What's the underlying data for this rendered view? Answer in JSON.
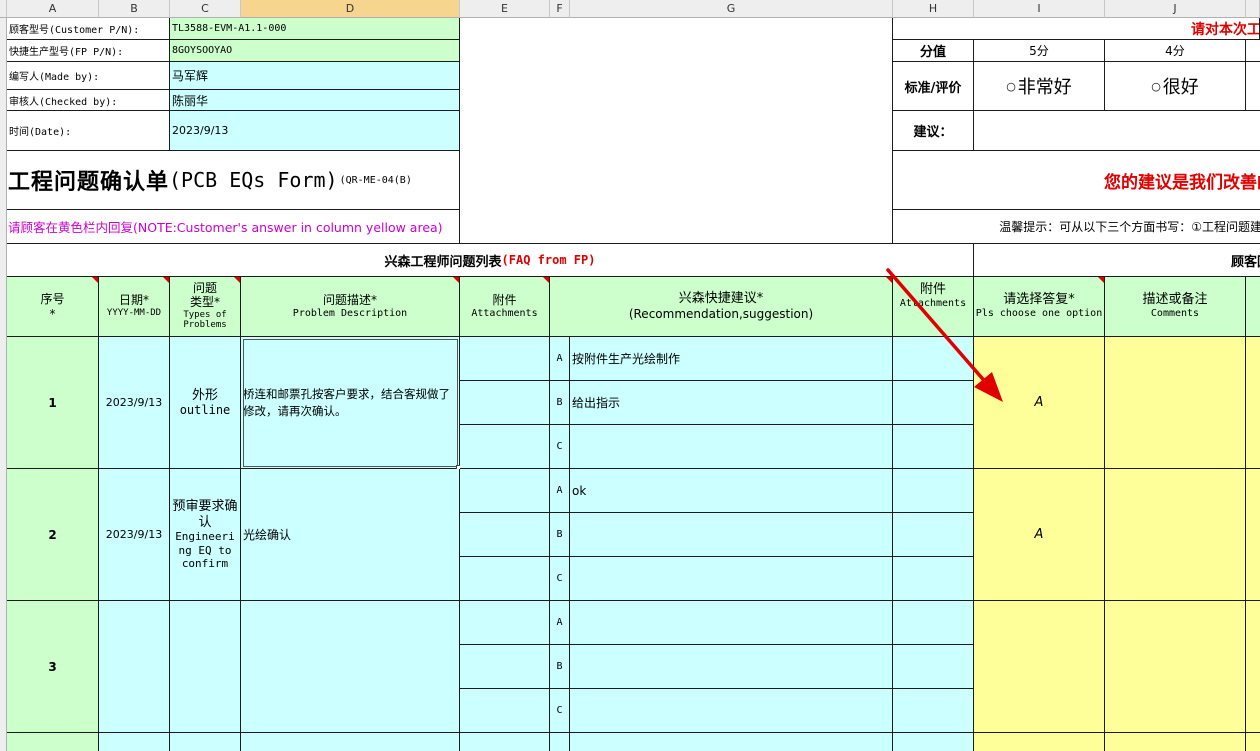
{
  "columns": [
    "A",
    "B",
    "C",
    "D",
    "E",
    "F",
    "G",
    "H",
    "I",
    "J"
  ],
  "info": {
    "customer_pn_label": "顾客型号(Customer P/N):",
    "customer_pn_value": "TL3588-EVM-A1.1-000",
    "fp_pn_label": "快捷生产型号(FP P/N):",
    "fp_pn_value": "8GOYSOOYAO",
    "made_by_label": "编写人(Made by):",
    "made_by_value": "马军辉",
    "checked_by_label": "审核人(Checked by):",
    "checked_by_value": "陈丽华",
    "date_label": "时间(Date):",
    "date_value": "2023/9/13"
  },
  "form": {
    "title_cn": "工程问题确认单",
    "title_en": "(PCB EQs Form)",
    "form_code": "(QR-ME-04(B)",
    "note": "请顾客在黄色栏内回复(NOTE:Customer's answer in column yellow area)"
  },
  "rating": {
    "top_red_text": "请对本次工",
    "score_label": "分值",
    "score_5": "5分",
    "score_4": "4分",
    "standard_label": "标准/评价",
    "option_5": "非常好",
    "option_4": "很好",
    "suggestion_label": "建议：",
    "suggestion_red_text": "您的建议是我们改善的",
    "tip_text": "温馨提示：可从以下三个方面书写：①工程问题建"
  },
  "section": {
    "left_title": "兴森工程师问题列表",
    "left_title_red": "(FAQ from FP)",
    "right_title": "顾客回"
  },
  "headers": {
    "seq": "序号",
    "seq_sub": "*",
    "date": "日期*",
    "date_sub": "YYYY-MM-DD",
    "type_1": "问题",
    "type_2": "类型*",
    "type_3": "Types of",
    "type_4": "Problems",
    "desc": "问题描述*",
    "desc_sub": "Problem Description",
    "attach": "附件",
    "attach_sub": "Attachments",
    "rec": "兴森快捷建议*",
    "rec_sub": "(Recommendation,suggestion)",
    "attach2": "附件",
    "attach2_sub": "Attachments",
    "choose": "请选择答复*",
    "choose_sub": "Pls choose one option",
    "comments": "描述或备注",
    "comments_sub": "Comments"
  },
  "rows": [
    {
      "seq": "1",
      "date": "2023/9/13",
      "type_cn": "外形",
      "type_en": "outline",
      "desc": "桥连和邮票孔按客户要求，结合客规做了修改，请再次确认。",
      "opts": [
        {
          "letter": "A",
          "text": "按附件生产光绘制作"
        },
        {
          "letter": "B",
          "text": "给出指示"
        },
        {
          "letter": "C",
          "text": ""
        }
      ],
      "answer": "A"
    },
    {
      "seq": "2",
      "date": "2023/9/13",
      "type_cn": "预审要求确认",
      "type_en": "Engineering EQ to confirm",
      "desc": "光绘确认",
      "opts": [
        {
          "letter": "A",
          "text": "ok"
        },
        {
          "letter": "B",
          "text": ""
        },
        {
          "letter": "C",
          "text": ""
        }
      ],
      "answer": "A"
    },
    {
      "seq": "3",
      "date": "",
      "type_cn": "",
      "type_en": "",
      "desc": "",
      "opts": [
        {
          "letter": "A",
          "text": ""
        },
        {
          "letter": "B",
          "text": ""
        },
        {
          "letter": "C",
          "text": ""
        }
      ],
      "answer": ""
    }
  ],
  "colors": {
    "cyan": "#ccffff",
    "green": "#ccffcc",
    "yellow": "#ffff99",
    "red": "#e00000",
    "magenta": "#cc00cc"
  }
}
